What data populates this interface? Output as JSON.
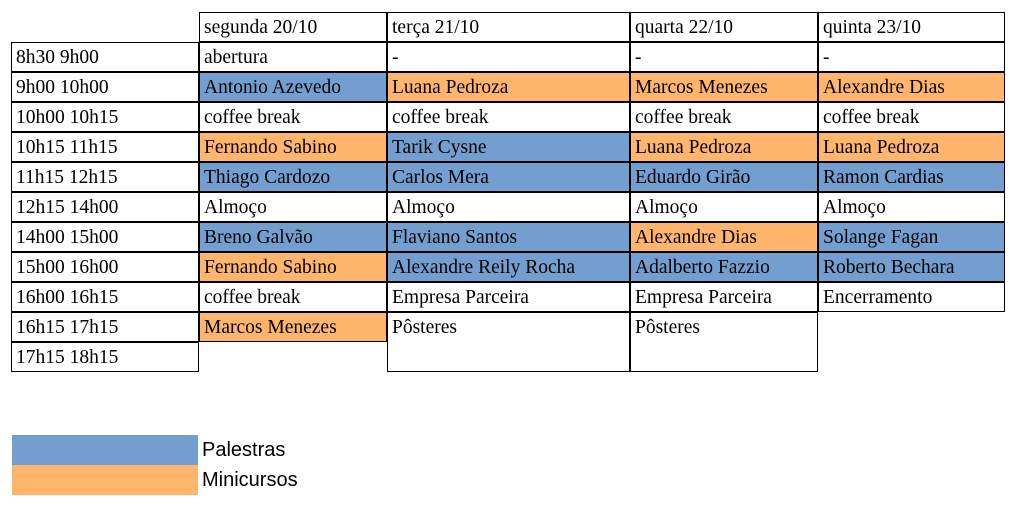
{
  "colors": {
    "palestra": "#729fcf",
    "minicurso": "#ffb66c"
  },
  "schedule": {
    "headers": [
      "",
      "segunda 20/10",
      "terça 21/10",
      "quarta 22/10",
      "quinta 23/10"
    ],
    "rows": [
      {
        "time": "8h30 9h00",
        "cells": [
          {
            "text": "abertura",
            "type": ""
          },
          {
            "text": "-",
            "type": ""
          },
          {
            "text": "-",
            "type": ""
          },
          {
            "text": "-",
            "type": ""
          }
        ]
      },
      {
        "time": "9h00 10h00",
        "cells": [
          {
            "text": "Antonio Azevedo",
            "type": "palestra"
          },
          {
            "text": "Luana Pedroza",
            "type": "minicurso"
          },
          {
            "text": "Marcos Menezes",
            "type": "minicurso"
          },
          {
            "text": "Alexandre Dias",
            "type": "minicurso"
          }
        ]
      },
      {
        "time": "10h00 10h15",
        "cells": [
          {
            "text": "coffee break",
            "type": ""
          },
          {
            "text": "coffee break",
            "type": ""
          },
          {
            "text": "coffee break",
            "type": ""
          },
          {
            "text": "coffee break",
            "type": ""
          }
        ]
      },
      {
        "time": "10h15 11h15",
        "cells": [
          {
            "text": "Fernando Sabino",
            "type": "minicurso"
          },
          {
            "text": "Tarik Cysne",
            "type": "palestra"
          },
          {
            "text": "Luana Pedroza",
            "type": "minicurso"
          },
          {
            "text": "Luana Pedroza",
            "type": "minicurso"
          }
        ]
      },
      {
        "time": "11h15 12h15",
        "cells": [
          {
            "text": "Thiago Cardozo",
            "type": "palestra"
          },
          {
            "text": "Carlos Mera",
            "type": "palestra"
          },
          {
            "text": "Eduardo Girão",
            "type": "palestra"
          },
          {
            "text": "Ramon Cardias",
            "type": "palestra"
          }
        ]
      },
      {
        "time": "12h15 14h00",
        "cells": [
          {
            "text": "Almoço",
            "type": ""
          },
          {
            "text": "Almoço",
            "type": ""
          },
          {
            "text": "Almoço",
            "type": ""
          },
          {
            "text": "Almoço",
            "type": ""
          }
        ]
      },
      {
        "time": "14h00 15h00",
        "cells": [
          {
            "text": "Breno Galvão",
            "type": "palestra"
          },
          {
            "text": "Flaviano Santos",
            "type": "palestra"
          },
          {
            "text": "Alexandre Dias",
            "type": "minicurso"
          },
          {
            "text": "Solange Fagan",
            "type": "palestra"
          }
        ]
      },
      {
        "time": "15h00 16h00",
        "cells": [
          {
            "text": "Fernando Sabino",
            "type": "minicurso"
          },
          {
            "text": "Alexandre Reily Rocha",
            "type": "palestra"
          },
          {
            "text": "Adalberto Fazzio",
            "type": "palestra"
          },
          {
            "text": "Roberto Bechara",
            "type": "palestra"
          }
        ]
      },
      {
        "time": "16h00 16h15",
        "cells": [
          {
            "text": "coffee break",
            "type": ""
          },
          {
            "text": "Empresa Parceira",
            "type": ""
          },
          {
            "text": "Empresa Parceira",
            "type": ""
          },
          {
            "text": "Encerramento",
            "type": ""
          }
        ]
      },
      {
        "time": "16h15 17h15",
        "cells": [
          {
            "text": "Marcos Menezes",
            "type": "minicurso"
          },
          {
            "text": "Pôsteres",
            "type": ""
          },
          {
            "text": "Pôsteres",
            "type": ""
          },
          null
        ]
      },
      {
        "time": "17h15 18h15",
        "cells": [
          null,
          null,
          null,
          null
        ]
      }
    ]
  },
  "legend": [
    {
      "label": "Palestras",
      "type": "palestra"
    },
    {
      "label": "Minicursos",
      "type": "minicurso"
    }
  ]
}
